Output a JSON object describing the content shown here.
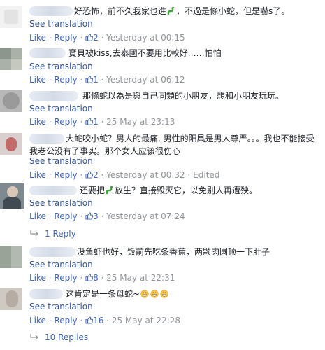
{
  "comments": [
    {
      "text": "好恐怖，前不久我家也進",
      "text2": "，不過是條小蛇，但是嚇s了。",
      "see": "See translation",
      "like": "Like",
      "reply": "Reply",
      "count": "2",
      "time": "Yesterday at 00:15",
      "edited": ""
    },
    {
      "text": "寶貝被kiss,去泰國不要用比較好……怕怕",
      "see": "See translation",
      "like": "Like",
      "reply": "Reply",
      "count": "1",
      "time": "Yesterday at 06:12",
      "edited": ""
    },
    {
      "text": "那條蛇以為是與自己同類的小朋友，想和小朋友玩玩。",
      "see": "See translation",
      "like": "Like",
      "reply": "Reply",
      "count": "1",
      "time": "25 May at 23:13",
      "edited": ""
    },
    {
      "text": "大蛇咬小蛇？男人的最痛, 男性的阳具是男人尊严。。。我也不能接受我老公没有了事实。那个女人应该很伤心",
      "see": "See translation",
      "like": "Like",
      "reply": "Reply",
      "count": "2",
      "time": "Yesterday at 00:32",
      "edited": "Edited"
    },
    {
      "text": "还要把",
      "text2": "放生？直接毁灭它，以免别人再遭殃。",
      "see": "See translation",
      "like": "Like",
      "reply": "Reply",
      "count": "3",
      "time": "Yesterday at 07:24",
      "edited": ""
    },
    {
      "text": "没鱼虾也好，饭前先吃条香蕉，两颗肉圆顶一下肚子",
      "see": "See translation",
      "like": "Like",
      "reply": "Reply",
      "count": "8",
      "time": "25 May at 22:31",
      "edited": ""
    },
    {
      "text": "这肯定是一条母蛇~",
      "see": "See translation",
      "like": "Like",
      "reply": "Reply",
      "count": "16",
      "time": "25 May at 22:28",
      "edited": ""
    }
  ],
  "replies_1": "1 Reply",
  "replies_2": "10 Replies",
  "colors": {
    "link": "#4267b2",
    "meta": "#90949c",
    "text": "#1d2129"
  },
  "icons": [
    "snake-emoji",
    "grinning-emoji",
    "thumbs-up-icon",
    "reply-arrow-icon"
  ]
}
